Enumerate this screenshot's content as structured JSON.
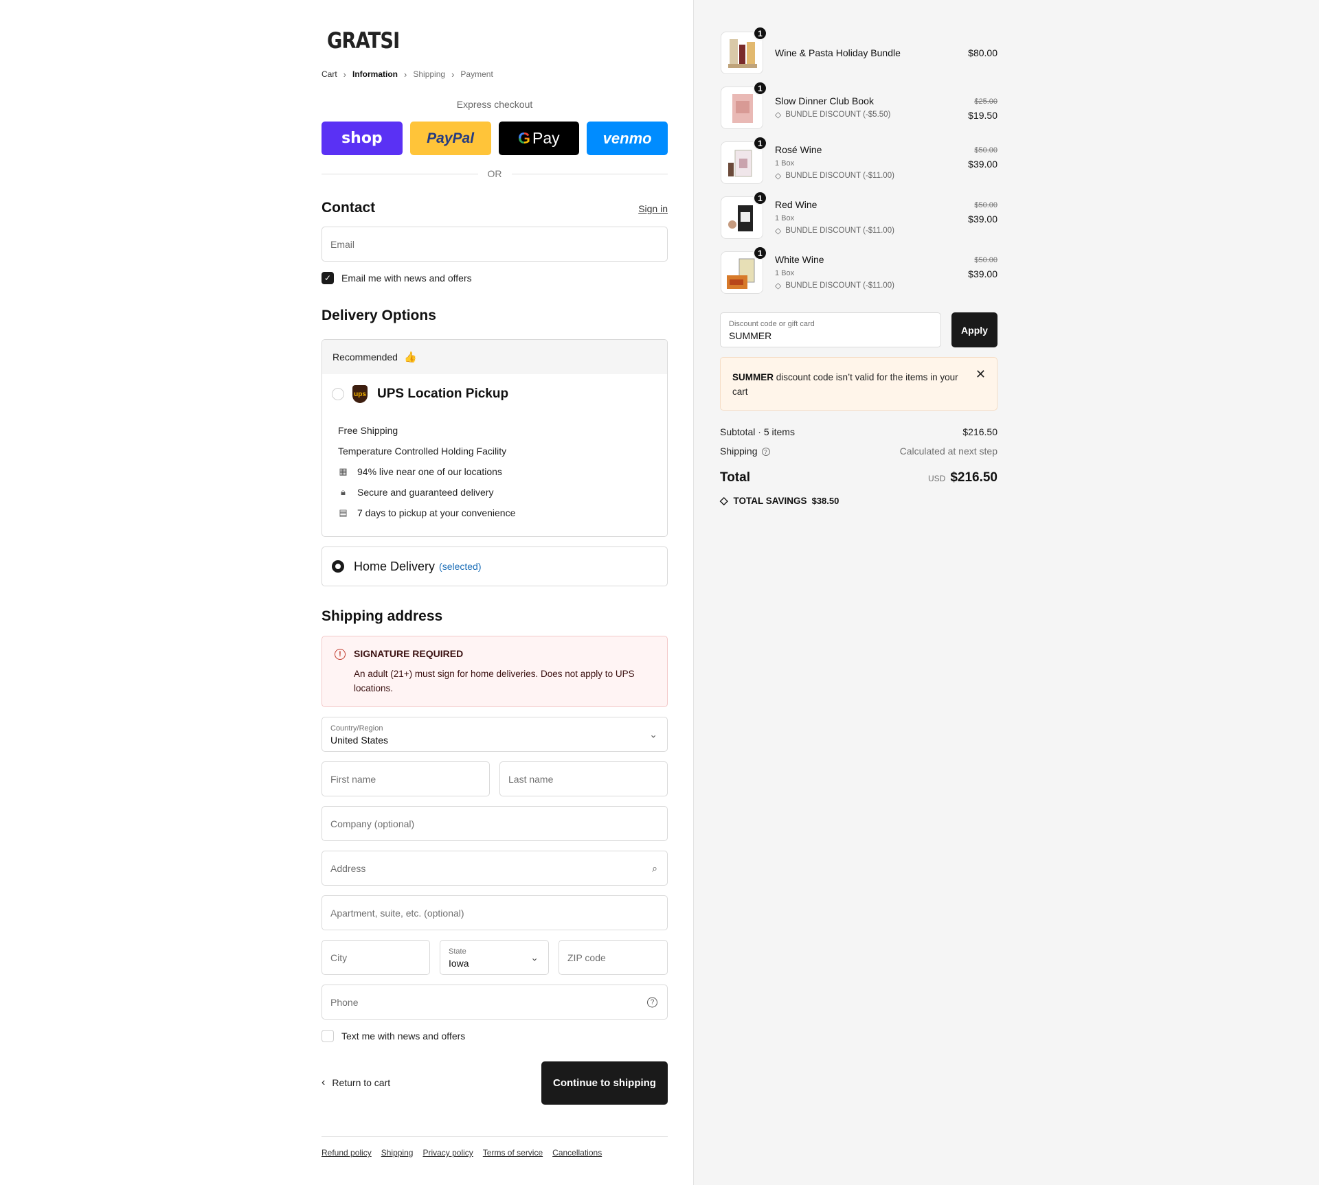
{
  "brand": "GRATSI",
  "breadcrumb": [
    "Cart",
    "Information",
    "Shipping",
    "Payment"
  ],
  "express": {
    "label": "Express checkout",
    "buttons": [
      "shop",
      "PayPal",
      "Pay",
      "venmo"
    ],
    "or": "OR"
  },
  "contact": {
    "heading": "Contact",
    "sign_in": "Sign in",
    "email_placeholder": "Email",
    "news_label": "Email me with news and offers",
    "news_checked": true
  },
  "delivery": {
    "heading": "Delivery Options",
    "recommended": "Recommended",
    "ups_title": "UPS Location Pickup",
    "features": [
      "Free Shipping",
      "Temperature Controlled Holding Facility",
      "94% live near one of our locations",
      "Secure and guaranteed delivery",
      "7 days to pickup at your convenience"
    ],
    "home_label": "Home Delivery",
    "home_selected": "(selected)"
  },
  "shipping": {
    "heading": "Shipping address",
    "alert_title": "SIGNATURE REQUIRED",
    "alert_body": "An adult (21+) must sign for home deliveries. Does not apply to UPS locations.",
    "country_label": "Country/Region",
    "country_value": "United States",
    "first_name": "First name",
    "last_name": "Last name",
    "company": "Company (optional)",
    "address": "Address",
    "apartment": "Apartment, suite, etc. (optional)",
    "city": "City",
    "state_label": "State",
    "state_value": "Iowa",
    "zip": "ZIP code",
    "phone": "Phone",
    "text_label": "Text me with news and offers"
  },
  "actions": {
    "return": "Return to cart",
    "continue": "Continue to shipping"
  },
  "footer_links": [
    "Refund policy",
    "Shipping",
    "Privacy policy",
    "Terms of service",
    "Cancellations"
  ],
  "cart": {
    "items": [
      {
        "name": "Wine & Pasta Holiday Bundle",
        "qty": "1",
        "price": "$80.00",
        "old_price": "",
        "sub": "",
        "discount": ""
      },
      {
        "name": "Slow Dinner Club Book",
        "qty": "1",
        "price": "$19.50",
        "old_price": "$25.00",
        "sub": "",
        "discount": "BUNDLE DISCOUNT (-$5.50)"
      },
      {
        "name": "Rosé Wine",
        "qty": "1",
        "price": "$39.00",
        "old_price": "$50.00",
        "sub": "1 Box",
        "discount": "BUNDLE DISCOUNT (-$11.00)"
      },
      {
        "name": "Red Wine",
        "qty": "1",
        "price": "$39.00",
        "old_price": "$50.00",
        "sub": "1 Box",
        "discount": "BUNDLE DISCOUNT (-$11.00)"
      },
      {
        "name": "White Wine",
        "qty": "1",
        "price": "$39.00",
        "old_price": "$50.00",
        "sub": "1 Box",
        "discount": "BUNDLE DISCOUNT (-$11.00)"
      }
    ],
    "discount_label": "Discount code or gift card",
    "discount_value": "SUMMER",
    "apply": "Apply",
    "warning_code": "SUMMER",
    "warning_text": " discount code isn’t valid for the items in your cart",
    "subtotal_label": "Subtotal · 5 items",
    "subtotal_value": "$216.50",
    "shipping_label": "Shipping",
    "shipping_value": "Calculated at next step",
    "total_label": "Total",
    "currency": "USD",
    "total_value": "$216.50",
    "savings_label": "TOTAL SAVINGS",
    "savings_value": "$38.50"
  }
}
